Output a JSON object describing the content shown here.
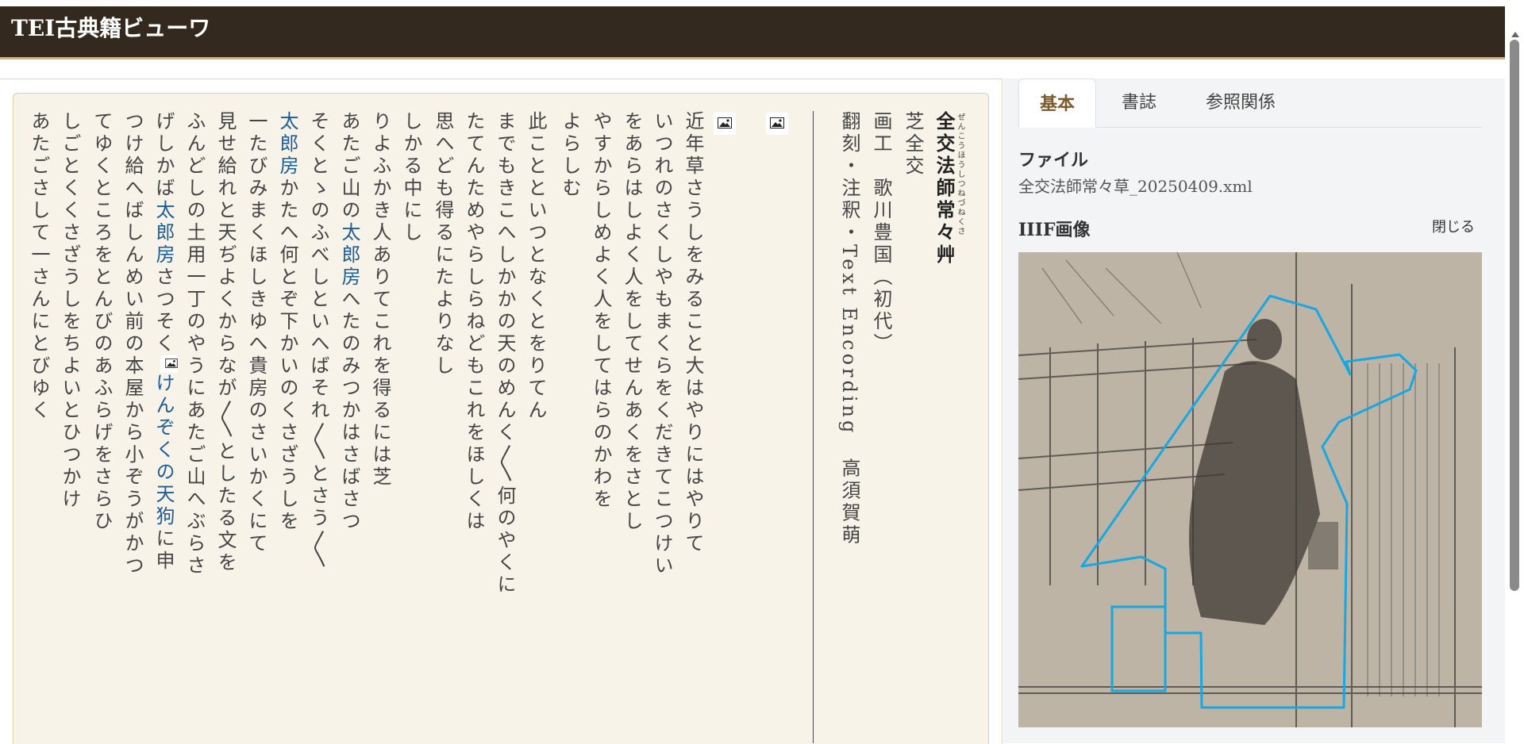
{
  "app": {
    "title": "TEI古典籍ビューワ"
  },
  "document": {
    "title": "全交法師常々艸",
    "title_ruby": "ぜんこうほうしつねづねくさ",
    "lines": [
      "芝全交",
      "画工　歌川豊国（初代）",
      "翻刻・注釈・Text Encording　高須賀萌"
    ],
    "body_lines": [
      {
        "text": "近年草さうしをみること大はやりにはやりて"
      },
      {
        "text": "いつれのさくしやもまくらをくだきてこつけい"
      },
      {
        "text": "をあらはしよく人をしてせんあくをさとし"
      },
      {
        "text": "やすからしめよく人をしてはらのかわを"
      },
      {
        "text": "よらしむ"
      },
      {
        "text": "此ことといつとなくとをりてん"
      },
      {
        "text": "までもきこへしかかの天のめんく〳〵何のやくに"
      },
      {
        "text": "たてんためやらしらねどもこれをほしくは"
      },
      {
        "text": "思へども得るにたよりなし"
      },
      {
        "text": "しかる中にし"
      },
      {
        "text": "りよふかき人ありてこれを得るには芝"
      },
      {
        "pre": "あたご山の",
        "link": "太郎房",
        "post": "へたのみつかはさばさつ"
      },
      {
        "text": "そくとゝのふべしといへばそれ〳〵とさう〳〵"
      },
      {
        "pre": "",
        "link": "太郎房",
        "post": "かたへ何とぞ下かいのくさざうしを"
      },
      {
        "text": "一たびみまくほしきゆへ貴房のさいかくにて"
      },
      {
        "text": "見せ給れと天ぢよくからなが〳〵としたる文を"
      },
      {
        "text": "ふんどしの土用一丁のやうにあたご山へぶらさ"
      },
      {
        "pre": "げしかば",
        "link": "太郎房",
        "mid": "さつそく",
        "link2": "けんぞくの天狗",
        "post": "に申"
      },
      {
        "text": "つけ給へばしんめい前の本屋から小ぞうがかつ"
      },
      {
        "text": "てゆくところをとんびのあふらげをさらひ"
      },
      {
        "text": "しごとくくさざうしをちよいとひつかけ"
      },
      {
        "text": "あたごさして一さんにとびゆく"
      }
    ]
  },
  "side_panel": {
    "tabs": [
      {
        "label": "基本",
        "active": true
      },
      {
        "label": "書誌",
        "active": false
      },
      {
        "label": "参照関係",
        "active": false
      }
    ],
    "file_label": "ファイル",
    "file_name": "全交法師常々草_20250409.xml",
    "iiif_label": "IIIF画像",
    "close_label": "閉じる"
  },
  "colors": {
    "header_bg": "#33291e",
    "accent": "#7b5a2c",
    "link": "#1d5c9a",
    "paper_bg": "#f7f3e8",
    "annotation_outline": "#1aa7e0"
  }
}
